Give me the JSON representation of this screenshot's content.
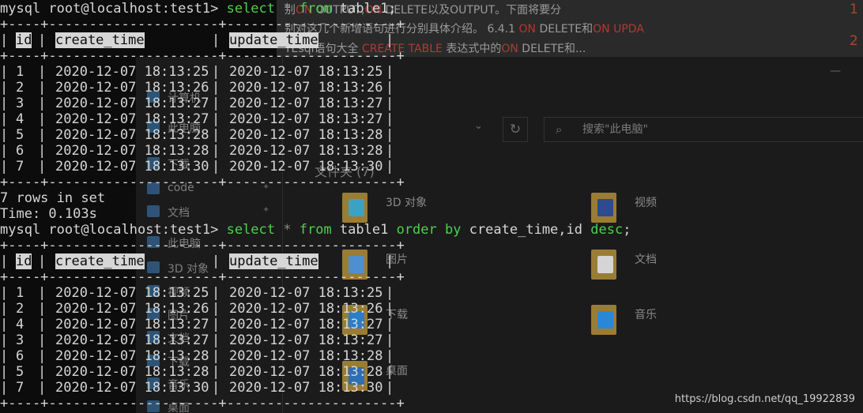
{
  "article": {
    "line1_parts": [
      "别",
      "ON",
      " OUTPUT,",
      "ON",
      " DELETE以及OUTPUT。下面将要分"
    ],
    "line2_parts": [
      "别对这几个新增语句进行分别具体介绍。 6.4.1 ",
      "ON",
      " DELETE和",
      "ON UPDA"
    ],
    "line3_parts": [
      "TEsql语句大全 ",
      "CREATE TABLE",
      " 表达式中的",
      "ON",
      " DELETE和..."
    ],
    "num1": "1",
    "num2": "2"
  },
  "explorer": {
    "minimize": "—",
    "search_placeholder": "搜索\"此电脑\"",
    "group_header": "文件夹 (7)",
    "nav_items": [
      "计算机",
      "此电脑",
      "下载",
      "code",
      "文档",
      "此电脑",
      "3D 对象",
      "视频",
      "图片",
      "文档",
      "下载",
      "音乐",
      "桌面"
    ],
    "folders": [
      {
        "label": "3D 对象",
        "color": "#3aa3c5"
      },
      {
        "label": "视频",
        "color": "#2f4b8e"
      },
      {
        "label": "图片",
        "color": "#4e8fcf"
      },
      {
        "label": "文档",
        "color": "#d5d5d5"
      },
      {
        "label": "下载",
        "color": "#2b7dc7"
      },
      {
        "label": "音乐",
        "color": "#2a87d8"
      },
      {
        "label": "桌面",
        "color": "#2d6fb5"
      }
    ]
  },
  "watermark": "https://blog.csdn.net/qq_19922839",
  "terminal": {
    "prompt": "mysql root@localhost:test1>",
    "query1": {
      "parts": [
        [
          "kw",
          "select"
        ],
        [
          "op",
          " * "
        ],
        [
          "kw",
          "from"
        ],
        [
          "id",
          " table1;"
        ]
      ]
    },
    "query2": {
      "parts": [
        [
          "kw",
          "select"
        ],
        [
          "op",
          " * "
        ],
        [
          "kw",
          "from"
        ],
        [
          "id",
          " table1 "
        ],
        [
          "kw",
          "order by"
        ],
        [
          "id",
          " create_time,id "
        ],
        [
          "kw",
          "desc"
        ],
        [
          "id",
          ";"
        ]
      ]
    },
    "border": "+----+---------------------+---------------------+",
    "columns": [
      "id",
      "create_time",
      "update_time"
    ],
    "result1": [
      [
        "1",
        "2020-12-07 18:13:25",
        "2020-12-07 18:13:25"
      ],
      [
        "2",
        "2020-12-07 18:13:26",
        "2020-12-07 18:13:26"
      ],
      [
        "3",
        "2020-12-07 18:13:27",
        "2020-12-07 18:13:27"
      ],
      [
        "4",
        "2020-12-07 18:13:27",
        "2020-12-07 18:13:27"
      ],
      [
        "5",
        "2020-12-07 18:13:28",
        "2020-12-07 18:13:28"
      ],
      [
        "6",
        "2020-12-07 18:13:28",
        "2020-12-07 18:13:28"
      ],
      [
        "7",
        "2020-12-07 18:13:30",
        "2020-12-07 18:13:30"
      ]
    ],
    "result2": [
      [
        "1",
        "2020-12-07 18:13:25",
        "2020-12-07 18:13:25"
      ],
      [
        "2",
        "2020-12-07 18:13:26",
        "2020-12-07 18:13:26"
      ],
      [
        "4",
        "2020-12-07 18:13:27",
        "2020-12-07 18:13:27"
      ],
      [
        "3",
        "2020-12-07 18:13:27",
        "2020-12-07 18:13:27"
      ],
      [
        "6",
        "2020-12-07 18:13:28",
        "2020-12-07 18:13:28"
      ],
      [
        "5",
        "2020-12-07 18:13:28",
        "2020-12-07 18:13:28"
      ],
      [
        "7",
        "2020-12-07 18:13:30",
        "2020-12-07 18:13:30"
      ]
    ],
    "rows_info": "7 rows in set",
    "time_info": "Time: 0.103s"
  },
  "colors": {
    "terminal_bg": "#0c0c0c",
    "keyword": "#4fcf4f",
    "text": "#d6d6d6",
    "header_bg": "#d6d6d6"
  }
}
